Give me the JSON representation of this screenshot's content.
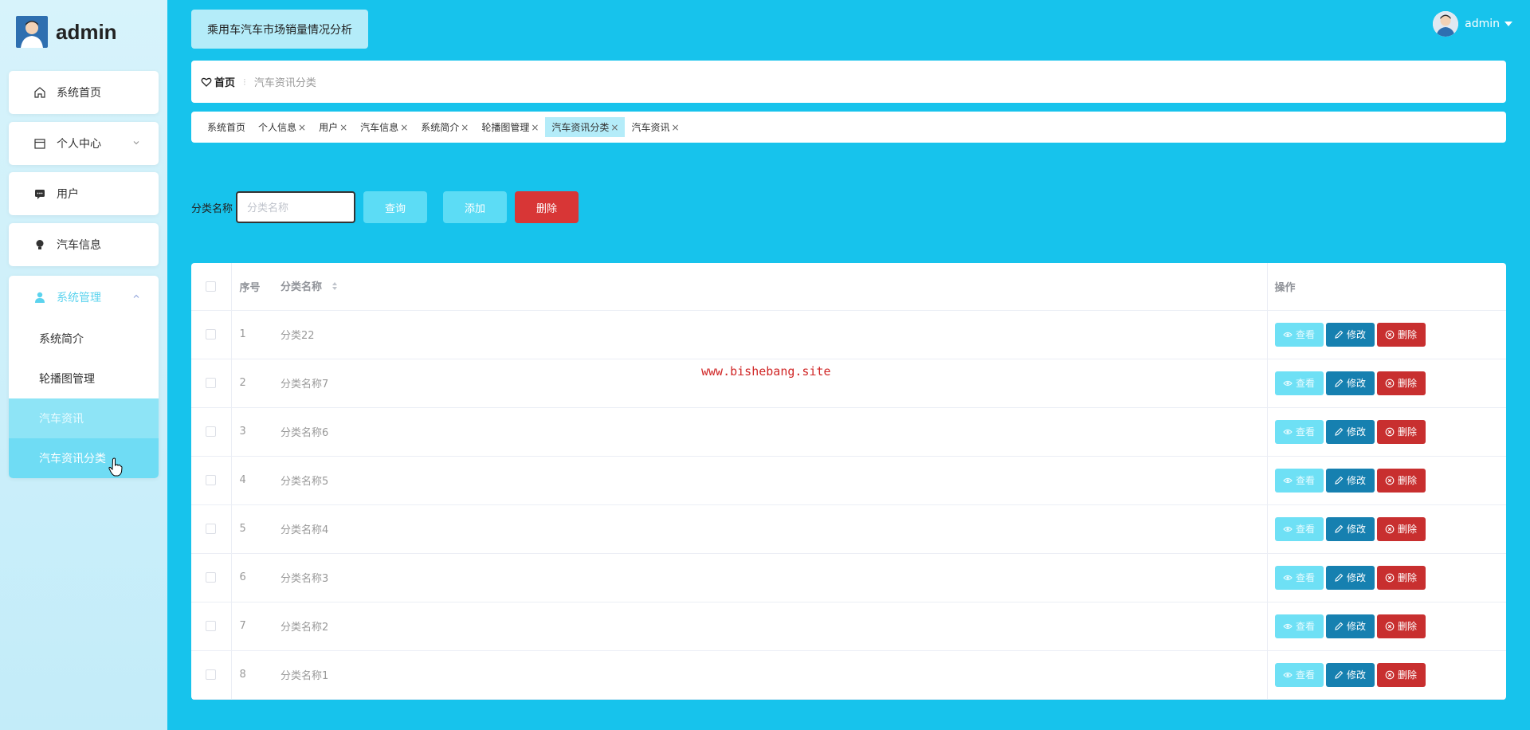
{
  "sidebar": {
    "brand": "admin",
    "items": [
      {
        "label": "系统首页",
        "icon": "home-icon"
      },
      {
        "label": "个人中心",
        "icon": "calendar-icon",
        "expandable": true
      },
      {
        "label": "用户",
        "icon": "chat-icon"
      },
      {
        "label": "汽车信息",
        "icon": "bulb-icon"
      }
    ],
    "group": {
      "label": "系统管理",
      "icon": "user-icon",
      "children": [
        "系统简介",
        "轮播图管理",
        "汽车资讯",
        "汽车资讯分类"
      ]
    }
  },
  "header": {
    "title": "乘用车汽车市场销量情况分析",
    "username": "admin"
  },
  "breadcrumb": {
    "home": "首页",
    "current": "汽车资讯分类"
  },
  "tags": [
    {
      "label": "系统首页",
      "closable": false
    },
    {
      "label": "个人信息",
      "closable": true
    },
    {
      "label": "用户",
      "closable": true
    },
    {
      "label": "汽车信息",
      "closable": true
    },
    {
      "label": "系统简介",
      "closable": true
    },
    {
      "label": "轮播图管理",
      "closable": true
    },
    {
      "label": "汽车资讯分类",
      "closable": true,
      "active": true
    },
    {
      "label": "汽车资讯",
      "closable": true
    }
  ],
  "search": {
    "label": "分类名称",
    "placeholder": "分类名称",
    "value": "",
    "query_label": "查询",
    "add_label": "添加",
    "delete_label": "删除"
  },
  "table": {
    "columns": {
      "index": "序号",
      "name": "分类名称",
      "ops": "操作"
    },
    "rows": [
      {
        "index": "1",
        "name": "分类22"
      },
      {
        "index": "2",
        "name": "分类名称7"
      },
      {
        "index": "3",
        "name": "分类名称6"
      },
      {
        "index": "4",
        "name": "分类名称5"
      },
      {
        "index": "5",
        "name": "分类名称4"
      },
      {
        "index": "6",
        "name": "分类名称3"
      },
      {
        "index": "7",
        "name": "分类名称2"
      },
      {
        "index": "8",
        "name": "分类名称1"
      }
    ],
    "actions": {
      "view": "查看",
      "edit": "修改",
      "delete": "删除"
    }
  },
  "watermark": "www.bishebang.site",
  "colors": {
    "background": "#17c3ec",
    "accent": "#5cdcf5",
    "danger": "#d83636",
    "edit": "#1680b0"
  }
}
